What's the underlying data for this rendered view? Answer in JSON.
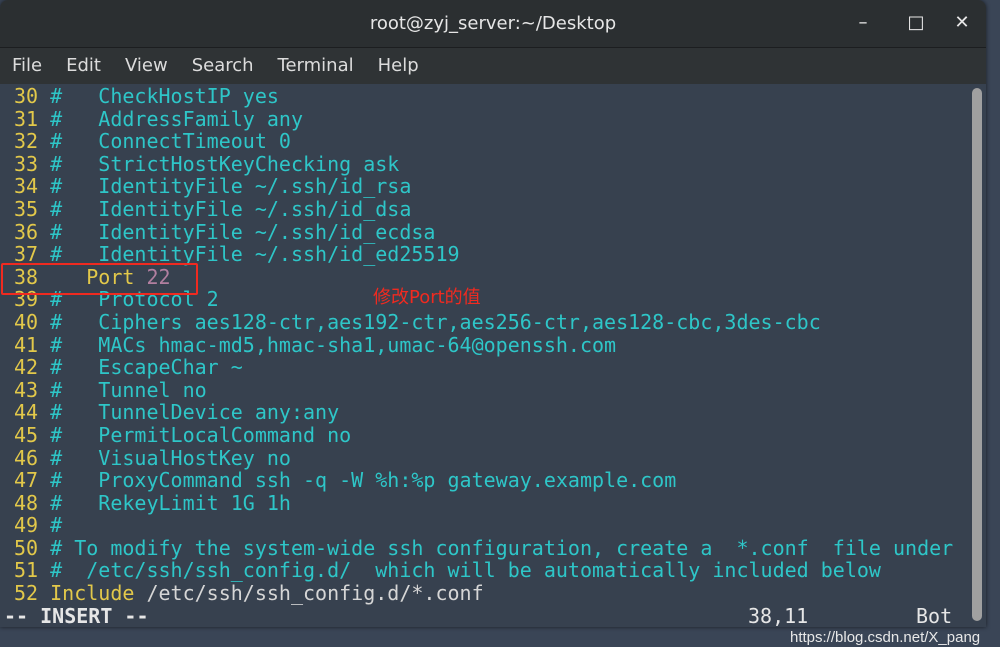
{
  "window": {
    "title": "root@zyj_server:~/Desktop",
    "minimize": "–",
    "maximize": "□",
    "close": "✕"
  },
  "menu": [
    "File",
    "Edit",
    "View",
    "Search",
    "Terminal",
    "Help"
  ],
  "lines": [
    {
      "num": "30",
      "segs": [
        [
          " #   CheckHostIP yes",
          "c"
        ]
      ]
    },
    {
      "num": "31",
      "segs": [
        [
          " #   AddressFamily any",
          "c"
        ]
      ]
    },
    {
      "num": "32",
      "segs": [
        [
          " #   ConnectTimeout 0",
          "c"
        ]
      ]
    },
    {
      "num": "33",
      "segs": [
        [
          " #   StrictHostKeyChecking ask",
          "c"
        ]
      ]
    },
    {
      "num": "34",
      "segs": [
        [
          " #   IdentityFile ~/.ssh/id_rsa",
          "c"
        ]
      ]
    },
    {
      "num": "35",
      "segs": [
        [
          " #   IdentityFile ~/.ssh/id_dsa",
          "c"
        ]
      ]
    },
    {
      "num": "36",
      "segs": [
        [
          " #   IdentityFile ~/.ssh/id_ecdsa",
          "c"
        ]
      ]
    },
    {
      "num": "37",
      "segs": [
        [
          " #   IdentityFile ~/.ssh/id_ed25519",
          "c"
        ]
      ]
    },
    {
      "num": "38",
      "segs": [
        [
          "    Port ",
          "y"
        ],
        [
          "22",
          "p"
        ]
      ]
    },
    {
      "num": "39",
      "segs": [
        [
          " #   Protocol 2",
          "c"
        ]
      ]
    },
    {
      "num": "40",
      "segs": [
        [
          " #   Ciphers aes128-ctr,aes192-ctr,aes256-ctr,aes128-cbc,3des-cbc",
          "c"
        ]
      ]
    },
    {
      "num": "41",
      "segs": [
        [
          " #   MACs hmac-md5,hmac-sha1,umac-64@openssh.com",
          "c"
        ]
      ]
    },
    {
      "num": "42",
      "segs": [
        [
          " #   EscapeChar ~",
          "c"
        ]
      ]
    },
    {
      "num": "43",
      "segs": [
        [
          " #   Tunnel no",
          "c"
        ]
      ]
    },
    {
      "num": "44",
      "segs": [
        [
          " #   TunnelDevice any:any",
          "c"
        ]
      ]
    },
    {
      "num": "45",
      "segs": [
        [
          " #   PermitLocalCommand no",
          "c"
        ]
      ]
    },
    {
      "num": "46",
      "segs": [
        [
          " #   VisualHostKey no",
          "c"
        ]
      ]
    },
    {
      "num": "47",
      "segs": [
        [
          " #   ProxyCommand ssh -q -W %h:%p gateway.example.com",
          "c"
        ]
      ]
    },
    {
      "num": "48",
      "segs": [
        [
          " #   RekeyLimit 1G 1h",
          "c"
        ]
      ]
    },
    {
      "num": "49",
      "segs": [
        [
          " #",
          "c"
        ]
      ]
    },
    {
      "num": "50",
      "segs": [
        [
          " # To modify the system-wide ssh configuration, create a  *.conf  file under",
          "c"
        ]
      ]
    },
    {
      "num": "51",
      "segs": [
        [
          " #  /etc/ssh/ssh_config.d/  which will be automatically included below",
          "c"
        ]
      ]
    },
    {
      "num": "52",
      "segs": [
        [
          " Include",
          "y"
        ],
        [
          " /etc/ssh/ssh_config.d/*.conf",
          "g"
        ]
      ]
    }
  ],
  "status": {
    "mode": "-- INSERT --",
    "position": "38,11",
    "scroll": "Bot"
  },
  "annotation": {
    "text": "修改Port的值",
    "color": "#f02a20"
  },
  "watermark": "https://blog.csdn.net/X_pang",
  "colors": {
    "background": "#37414f",
    "comment": "#2ec6c8",
    "line_number": "#e2c84a",
    "number": "#b27fa0"
  }
}
